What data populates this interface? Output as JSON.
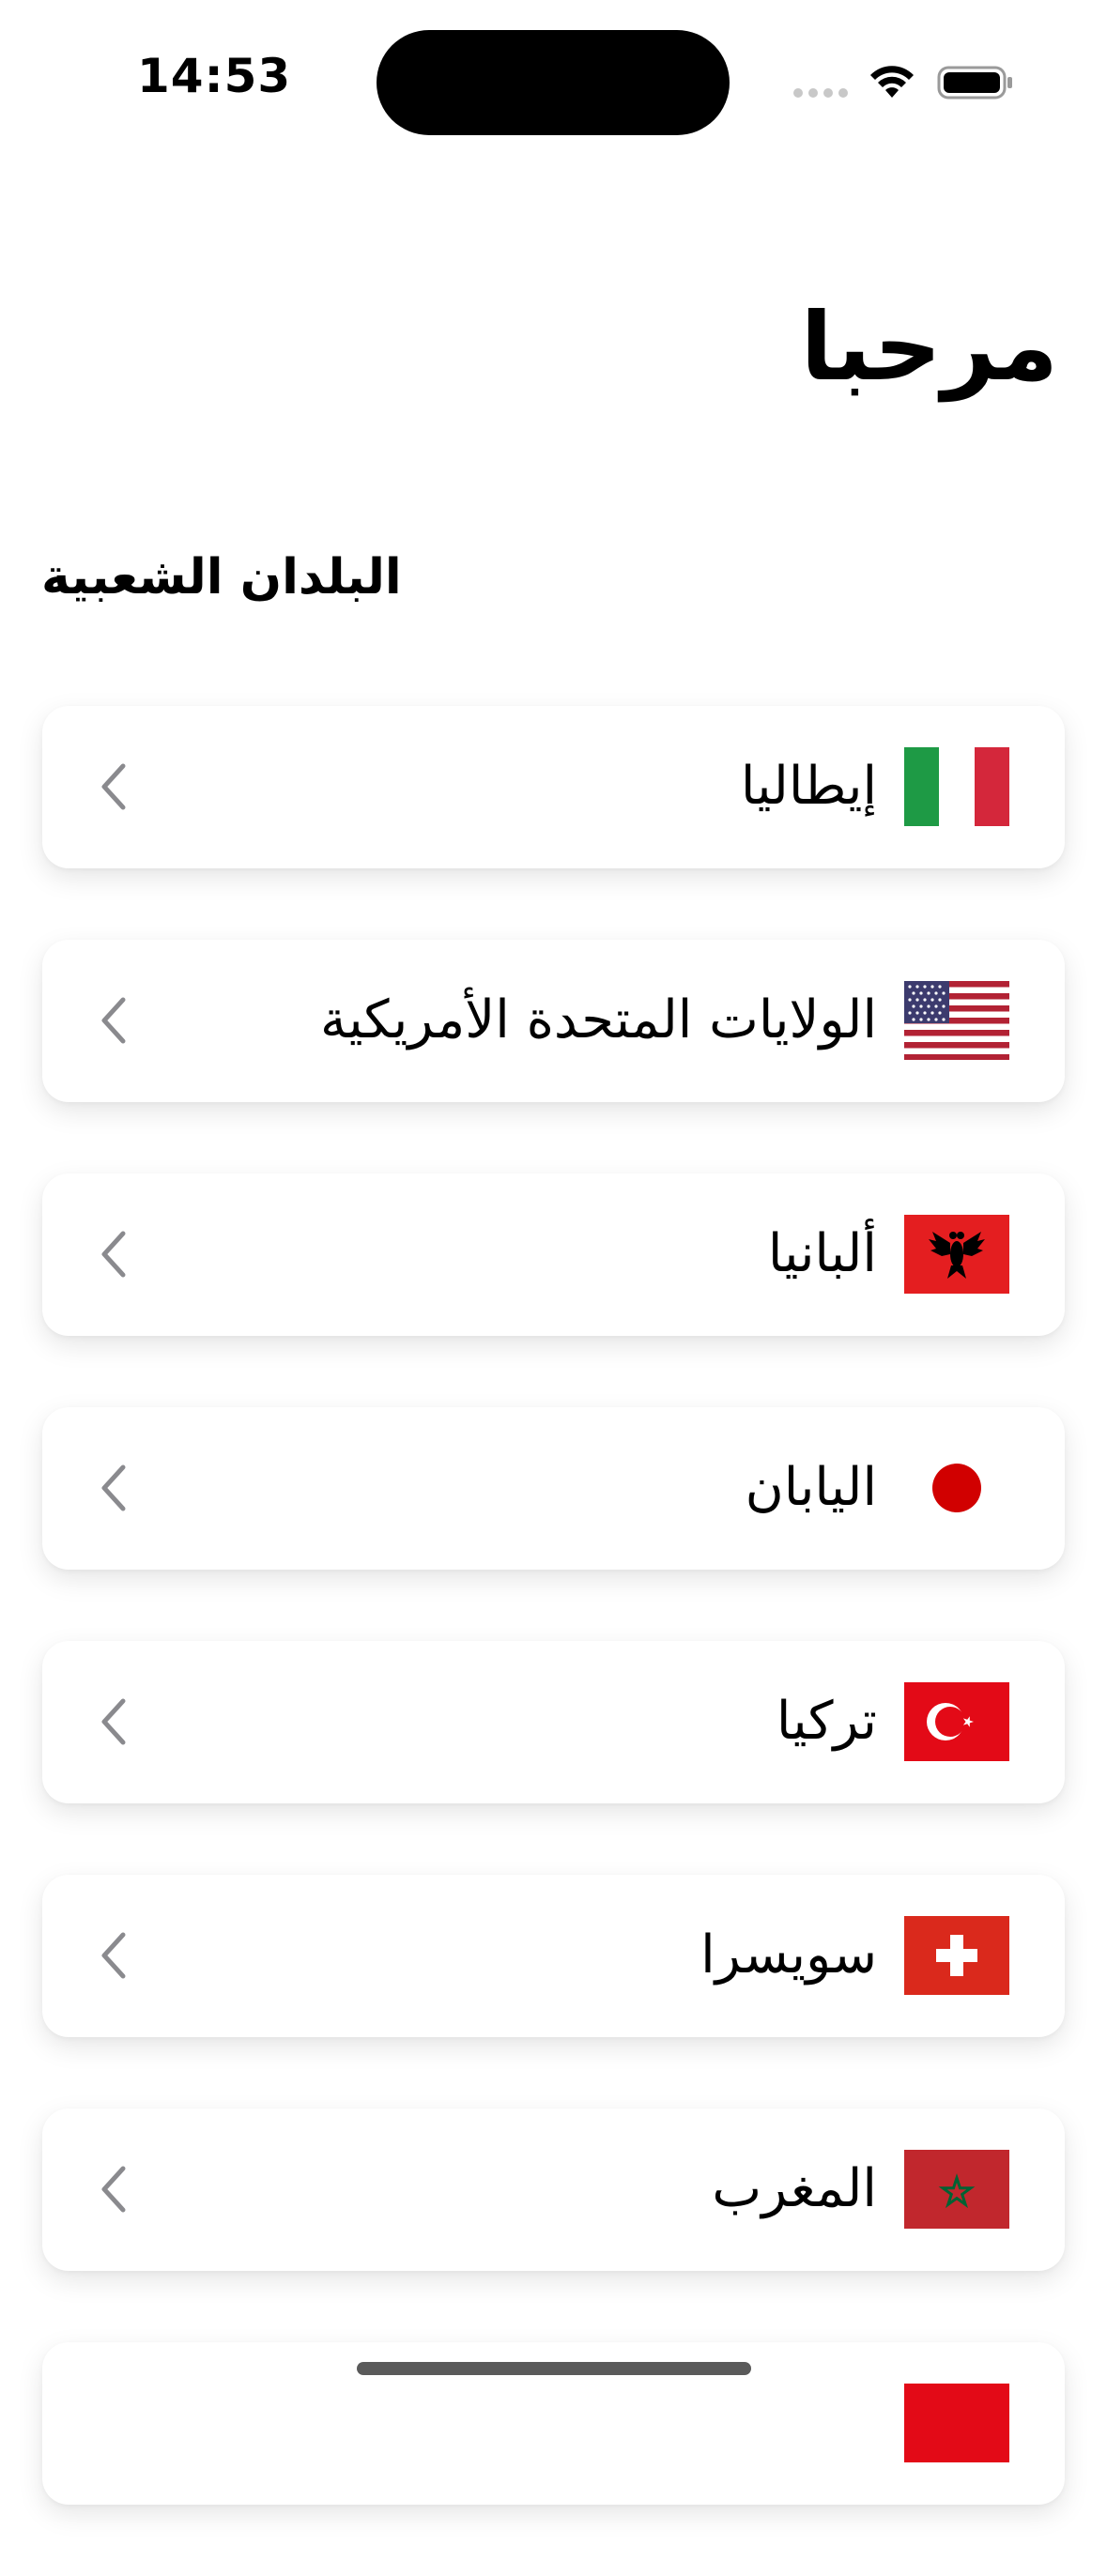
{
  "status_bar": {
    "time": "14:53"
  },
  "header": {
    "title": "مرحبا"
  },
  "section": {
    "title": "البلدان الشعبية"
  },
  "countries": [
    {
      "name": "إيطاليا",
      "flag_icon": "italy-flag-icon"
    },
    {
      "name": "الولايات المتحدة الأمريكية",
      "flag_icon": "usa-flag-icon"
    },
    {
      "name": "ألبانيا",
      "flag_icon": "albania-flag-icon"
    },
    {
      "name": "اليابان",
      "flag_icon": "japan-flag-icon"
    },
    {
      "name": "تركيا",
      "flag_icon": "turkey-flag-icon"
    },
    {
      "name": "سويسرا",
      "flag_icon": "switzerland-flag-icon"
    },
    {
      "name": "المغرب",
      "flag_icon": "morocco-flag-icon"
    },
    {
      "name": "",
      "flag_icon": "partial-flag-icon"
    }
  ],
  "colors": {
    "background": "#ffffff",
    "card": "#ffffff",
    "chevron": "#8a8a8e",
    "italy_green": "#1e9a45",
    "italy_red": "#d4273b",
    "usa_red": "#b22234",
    "usa_blue": "#3c3b6e",
    "albania_red": "#e41e20",
    "japan_red": "#d10000",
    "turkey_red": "#e30a17",
    "switzerland_red": "#da291c",
    "morocco_red": "#c1272d",
    "morocco_green": "#006233"
  }
}
